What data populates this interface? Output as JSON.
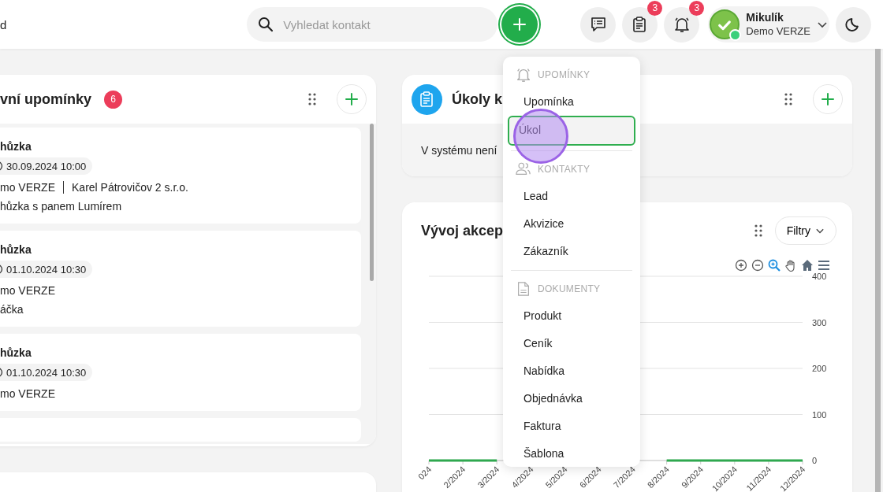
{
  "top_bar": {
    "cut_text": "d",
    "search": {
      "placeholder": "Vyhledat kontakt"
    },
    "icon_buttons": [
      {
        "kind": "messages"
      },
      {
        "kind": "tasks",
        "badge": "3"
      },
      {
        "kind": "notifications",
        "badge": "3"
      }
    ],
    "user": {
      "name": "Mikulík",
      "org": "Demo VERZE",
      "online": true
    }
  },
  "reminders_panel": {
    "title": "vní upomínky",
    "count": "6",
    "items": [
      {
        "title": "hůzka",
        "time": "30.09.2024 10:00",
        "contact": "mo VERZE",
        "company": "Karel Pátrovičov 2 s.r.o.",
        "note": "hůzka s panem Lumírem"
      },
      {
        "title": "hůzka",
        "time": "01.10.2024 10:30",
        "contact": "mo VERZE",
        "note": "áčka"
      },
      {
        "title": "hůzka",
        "time": "01.10.2024 10:30",
        "contact": "mo VERZE"
      }
    ]
  },
  "tasks_panel": {
    "title": "Úkoly k",
    "empty_text": "V systému není"
  },
  "chart_panel": {
    "title": "Vývoj akcep",
    "filter_button": "Filtry",
    "chart_data": {
      "type": "line",
      "categories": [
        "024",
        "2/2024",
        "3/2024",
        "4/2024",
        "5/2024",
        "6/2024",
        "7/2024",
        "8/2024",
        "9/2024",
        "10/2024",
        "11/2024",
        "12/2024"
      ],
      "series": [
        {
          "color": "#2fa84f",
          "values": [
            0,
            0,
            0,
            null,
            null,
            null,
            null,
            0,
            0,
            0,
            0,
            0
          ]
        }
      ],
      "grid": true,
      "ylim": [
        0,
        400
      ],
      "yticks": [
        0,
        100,
        200,
        300,
        400
      ]
    }
  },
  "add_menu": {
    "sections": [
      {
        "kind": "reminders",
        "title": "UPOMÍNKY",
        "items": [
          {
            "label": "Upomínka",
            "selected": false
          },
          {
            "label": "Úkol",
            "selected": true
          }
        ]
      },
      {
        "kind": "contacts",
        "title": "KONTAKTY",
        "items": [
          {
            "label": "Lead",
            "selected": false
          },
          {
            "label": "Akvizice",
            "selected": false
          },
          {
            "label": "Zákazník",
            "selected": false
          }
        ]
      },
      {
        "kind": "documents",
        "title": "DOKUMENTY",
        "items": [
          {
            "label": "Produkt",
            "selected": false
          },
          {
            "label": "Ceník",
            "selected": false
          },
          {
            "label": "Nabídka",
            "selected": false
          },
          {
            "label": "Objednávka",
            "selected": false
          },
          {
            "label": "Faktura",
            "selected": false
          },
          {
            "label": "Šablona",
            "selected": false
          }
        ]
      }
    ]
  }
}
